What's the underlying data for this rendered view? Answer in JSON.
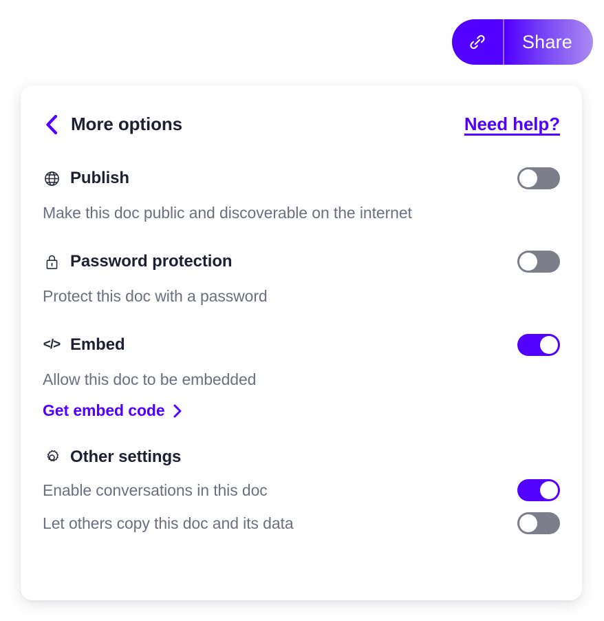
{
  "share": {
    "link_icon": "link-icon",
    "label": "Share",
    "accent_start": "#5200ff",
    "accent_end": "#a98bf0"
  },
  "card": {
    "header": {
      "back_icon": "chevron-left-icon",
      "title": "More options",
      "help_link": "Need help?"
    },
    "sections": [
      {
        "key": "publish",
        "icon": "globe-icon",
        "title": "Publish",
        "description": "Make this doc public and discoverable on the internet",
        "toggle_state": "off"
      },
      {
        "key": "password",
        "icon": "lock-icon",
        "title": "Password protection",
        "description": "Protect this doc with a password",
        "toggle_state": "off"
      },
      {
        "key": "embed",
        "icon": "code-icon",
        "icon_glyph": "</>",
        "title": "Embed",
        "description": "Allow this doc to be embedded",
        "link": "Get embed code",
        "link_icon": "chevron-right-icon",
        "toggle_state": "on"
      }
    ],
    "other": {
      "icon": "gear-icon",
      "title": "Other settings",
      "options": [
        {
          "key": "conversations",
          "label": "Enable conversations in this doc",
          "toggle_state": "on"
        },
        {
          "key": "copy",
          "label": "Let others copy this doc and its data",
          "toggle_state": "off"
        }
      ]
    }
  },
  "colors": {
    "accent": "#5200ff",
    "toggle_off": "#7c7f8a",
    "heading": "#1d2033",
    "muted": "#6b6f7e",
    "card_bg": "#ffffff",
    "page_bg": "#ffffff"
  }
}
